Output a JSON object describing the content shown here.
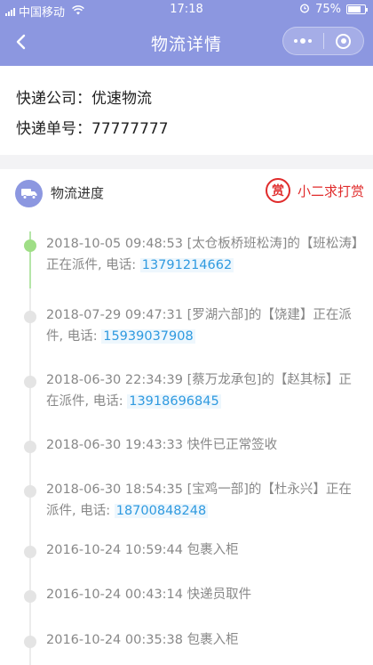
{
  "status_bar": {
    "carrier": "中国移动",
    "time": "17:18",
    "battery": "75%",
    "battery_level": 0.75
  },
  "nav": {
    "title": "物流详情",
    "back_icon": "chevron-left-icon",
    "menu_icon": "more-dots-icon",
    "close_icon": "target-icon"
  },
  "info": {
    "company_label": "快递公司：",
    "company_value": "优速物流",
    "number_label": "快递单号：",
    "number_value": "77777777"
  },
  "progress": {
    "title": "物流进度",
    "reward_badge": "赏",
    "reward_text": "小二求打赏",
    "events": [
      {
        "text": "2018-10-05 09:48:53 [太仓板桥班松涛]的【班松涛】正在派件, 电话: ",
        "phone": "13791214662",
        "active": true
      },
      {
        "text": "2018-07-29 09:47:31 [罗湖六部]的【饶建】正在派件, 电话: ",
        "phone": "15939037908",
        "active": false
      },
      {
        "text": "2018-06-30 22:34:39 [蔡万龙承包]的【赵其标】正在派件, 电话: ",
        "phone": "13918696845",
        "active": false
      },
      {
        "text": "2018-06-30 19:43:33 快件已正常签收",
        "phone": "",
        "active": false
      },
      {
        "text": "2018-06-30 18:54:35 [宝鸡一部]的【杜永兴】正在派件, 电话: ",
        "phone": "18700848248",
        "active": false
      },
      {
        "text": "2016-10-24 10:59:44 包裹入柜",
        "phone": "",
        "active": false
      },
      {
        "text": "2016-10-24 00:43:14 快递员取件",
        "phone": "",
        "active": false
      },
      {
        "text": "2016-10-24 00:35:38 包裹入柜",
        "phone": "",
        "active": false
      }
    ]
  },
  "colors": {
    "header": "#8c97e0",
    "accent_red": "#e02b2b",
    "phone_blue": "#2f9ae0",
    "active_green": "#9fde86"
  }
}
